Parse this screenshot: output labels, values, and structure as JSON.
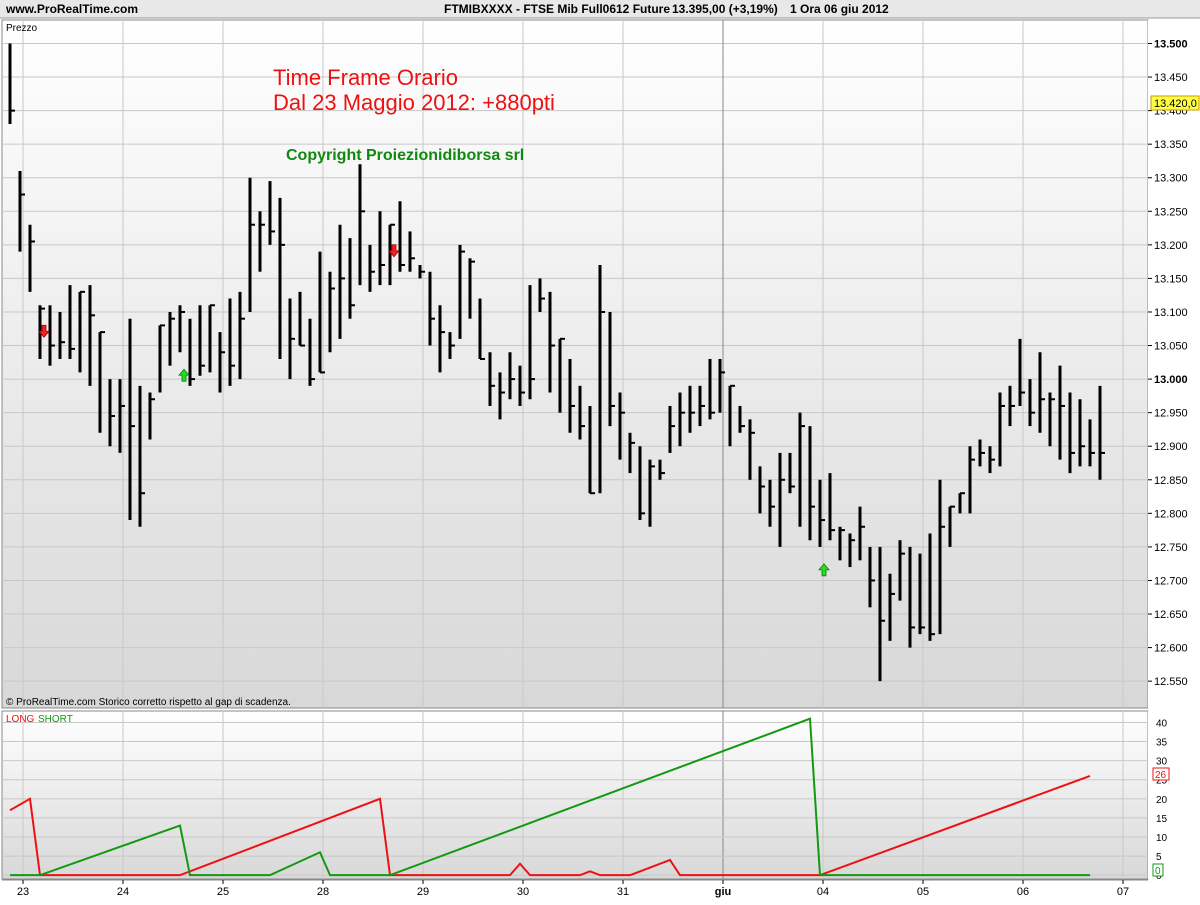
{
  "header": {
    "site": "www.ProRealTime.com",
    "ticker": "FTMIBXXXX - FTSE Mib Full0612 Future",
    "quote": "13.395,00 (+3,19%)",
    "timeframe_date": "1 Ora  06 giu 2012"
  },
  "price_panel": {
    "label": "Prezzo",
    "footer": "© ProRealTime.com  Storico corretto rispetto al gap di scadenza.",
    "last_price_tag": "13.420,0"
  },
  "annotations": {
    "title_line1": "Time Frame Orario",
    "title_line2": "Dal 23 Maggio 2012: +880pti",
    "copyright": "Copyright Proiezionidiborsa srl"
  },
  "indicator_panel": {
    "legend_long": "LONG",
    "legend_short": "SHORT",
    "last_long_tag": "26",
    "last_short_tag": "0"
  },
  "colors": {
    "long": "#ee1111",
    "short": "#119911",
    "bars": "#000000",
    "grid": "#c8c8c8",
    "annotation_red": "#ee1111",
    "annotation_green": "#118811",
    "arrow_up": "#22dd22",
    "arrow_down": "#ee2222"
  },
  "chart_data": [
    {
      "type": "bar",
      "subtype": "ohlc",
      "yticks": [
        "12.550",
        "12.600",
        "12.650",
        "12.700",
        "12.750",
        "12.800",
        "12.850",
        "12.900",
        "12.950",
        "13.000",
        "13.050",
        "13.100",
        "13.150",
        "13.200",
        "13.250",
        "13.300",
        "13.350",
        "13.400",
        "13.450",
        "13.500"
      ],
      "ylim": [
        12510,
        13535
      ],
      "grid": true,
      "x_labels": [
        {
          "bar": 0,
          "label": "23"
        },
        {
          "bar": 10,
          "label": "24"
        },
        {
          "bar": 20,
          "label": "25"
        },
        {
          "bar": 30,
          "label": "28"
        },
        {
          "bar": 40,
          "label": "29"
        },
        {
          "bar": 50,
          "label": "30"
        },
        {
          "bar": 60,
          "label": "31"
        },
        {
          "bar": 70,
          "label": "giu"
        },
        {
          "bar": 80,
          "label": "04"
        },
        {
          "bar": 90,
          "label": "05"
        },
        {
          "bar": 100,
          "label": "06"
        },
        {
          "bar": 110,
          "label": "07"
        }
      ],
      "bars": [
        [
          13500,
          13380,
          13400
        ],
        [
          13310,
          13190,
          13275
        ],
        [
          13230,
          13130,
          13205
        ],
        [
          13110,
          13030,
          13105
        ],
        [
          13110,
          13020,
          13050
        ],
        [
          13100,
          13030,
          13055
        ],
        [
          13140,
          13030,
          13045
        ],
        [
          13130,
          13010,
          13130
        ],
        [
          13140,
          12990,
          13095
        ],
        [
          13070,
          12920,
          13070
        ],
        [
          13000,
          12900,
          12945
        ],
        [
          13000,
          12890,
          12960
        ],
        [
          13090,
          12790,
          12930
        ],
        [
          12990,
          12780,
          12830
        ],
        [
          12980,
          12910,
          12970
        ],
        [
          13080,
          12980,
          13080
        ],
        [
          13100,
          13020,
          13090
        ],
        [
          13110,
          13040,
          13100
        ],
        [
          13090,
          12990,
          13000
        ],
        [
          13110,
          13005,
          13020
        ],
        [
          13110,
          13010,
          13110
        ],
        [
          13070,
          12980,
          13040
        ],
        [
          13120,
          12990,
          13020
        ],
        [
          13130,
          13000,
          13090
        ],
        [
          13300,
          13100,
          13230
        ],
        [
          13250,
          13160,
          13230
        ],
        [
          13295,
          13200,
          13220
        ],
        [
          13270,
          13030,
          13200
        ],
        [
          13120,
          13000,
          13060
        ],
        [
          13130,
          13050,
          13050
        ],
        [
          13090,
          12990,
          13000
        ],
        [
          13190,
          13010,
          13010
        ],
        [
          13160,
          13040,
          13135
        ],
        [
          13230,
          13060,
          13150
        ],
        [
          13210,
          13090,
          13110
        ],
        [
          13320,
          13140,
          13250
        ],
        [
          13200,
          13130,
          13160
        ],
        [
          13250,
          13140,
          13170
        ],
        [
          13230,
          13140,
          13230
        ],
        [
          13265,
          13160,
          13170
        ],
        [
          13220,
          13160,
          13180
        ],
        [
          13170,
          13150,
          13160
        ],
        [
          13160,
          13050,
          13090
        ],
        [
          13110,
          13010,
          13070
        ],
        [
          13070,
          13030,
          13050
        ],
        [
          13200,
          13060,
          13190
        ],
        [
          13180,
          13090,
          13175
        ],
        [
          13120,
          13030,
          13030
        ],
        [
          13040,
          12960,
          12990
        ],
        [
          13010,
          12940,
          12980
        ],
        [
          13040,
          12970,
          13000
        ],
        [
          13020,
          12960,
          12980
        ],
        [
          13140,
          12970,
          13000
        ],
        [
          13150,
          13100,
          13120
        ],
        [
          13130,
          12980,
          13050
        ],
        [
          13060,
          12950,
          13060
        ],
        [
          13030,
          12920,
          12960
        ],
        [
          12990,
          12910,
          12930
        ],
        [
          12960,
          12830,
          12830
        ],
        [
          13170,
          12830,
          13100
        ],
        [
          13100,
          12930,
          12960
        ],
        [
          12980,
          12880,
          12950
        ],
        [
          12920,
          12860,
          12905
        ],
        [
          12900,
          12790,
          12800
        ],
        [
          12880,
          12780,
          12870
        ],
        [
          12880,
          12850,
          12860
        ],
        [
          12960,
          12890,
          12930
        ],
        [
          12980,
          12900,
          12950
        ],
        [
          12990,
          12920,
          12950
        ],
        [
          12990,
          12930,
          12960
        ],
        [
          13030,
          12940,
          12950
        ],
        [
          13030,
          12950,
          13010
        ],
        [
          12990,
          12900,
          12990
        ],
        [
          12960,
          12920,
          12930
        ],
        [
          12940,
          12850,
          12920
        ],
        [
          12870,
          12800,
          12840
        ],
        [
          12850,
          12780,
          12810
        ],
        [
          12890,
          12750,
          12850
        ],
        [
          12890,
          12830,
          12840
        ],
        [
          12950,
          12780,
          12930
        ],
        [
          12930,
          12760,
          12810
        ],
        [
          12850,
          12750,
          12790
        ],
        [
          12860,
          12760,
          12775
        ],
        [
          12780,
          12730,
          12775
        ],
        [
          12770,
          12720,
          12760
        ],
        [
          12810,
          12730,
          12780
        ],
        [
          12750,
          12660,
          12700
        ],
        [
          12750,
          12550,
          12640
        ],
        [
          12710,
          12610,
          12680
        ],
        [
          12760,
          12670,
          12740
        ],
        [
          12750,
          12600,
          12630
        ],
        [
          12740,
          12620,
          12630
        ],
        [
          12770,
          12610,
          12620
        ],
        [
          12850,
          12620,
          12780
        ],
        [
          12810,
          12750,
          12810
        ],
        [
          12830,
          12800,
          12830
        ],
        [
          12900,
          12800,
          12880
        ],
        [
          12910,
          12870,
          12890
        ],
        [
          12900,
          12860,
          12880
        ],
        [
          12980,
          12870,
          12960
        ],
        [
          12990,
          12930,
          12960
        ],
        [
          13060,
          12960,
          12980
        ],
        [
          13000,
          12930,
          12950
        ],
        [
          13040,
          12920,
          12970
        ],
        [
          12980,
          12900,
          12970
        ],
        [
          13020,
          12880,
          12960
        ],
        [
          12980,
          12860,
          12890
        ],
        [
          12970,
          12870,
          12900
        ],
        [
          12940,
          12870,
          12890
        ],
        [
          12990,
          12850,
          12890
        ]
      ],
      "signals": [
        {
          "bar": 3,
          "type": "sell"
        },
        {
          "bar": 17,
          "type": "buy"
        },
        {
          "bar": 38,
          "type": "sell"
        },
        {
          "bar": 81,
          "type": "buy"
        }
      ]
    },
    {
      "type": "line",
      "yticks": [
        0,
        5,
        10,
        15,
        20,
        25,
        30,
        35,
        40
      ],
      "ylim": [
        -1,
        43
      ],
      "series": [
        {
          "name": "LONG",
          "points": [
            [
              0,
              17
            ],
            [
              2,
              20
            ],
            [
              3,
              0
            ],
            [
              17,
              0
            ],
            [
              37,
              20
            ],
            [
              38,
              0
            ],
            [
              50,
              0
            ],
            [
              51,
              3
            ],
            [
              52,
              0
            ],
            [
              57,
              0
            ],
            [
              58,
              1
            ],
            [
              59,
              0
            ],
            [
              62,
              0
            ],
            [
              66,
              4
            ],
            [
              67,
              0
            ],
            [
              81,
              0
            ],
            [
              108,
              26
            ]
          ]
        },
        {
          "name": "SHORT",
          "points": [
            [
              0,
              0
            ],
            [
              3,
              0
            ],
            [
              17,
              13
            ],
            [
              18,
              0
            ],
            [
              26,
              0
            ],
            [
              31,
              6
            ],
            [
              32,
              0
            ],
            [
              38,
              0
            ],
            [
              80,
              41
            ],
            [
              81,
              0
            ],
            [
              108,
              0
            ]
          ]
        }
      ]
    }
  ]
}
